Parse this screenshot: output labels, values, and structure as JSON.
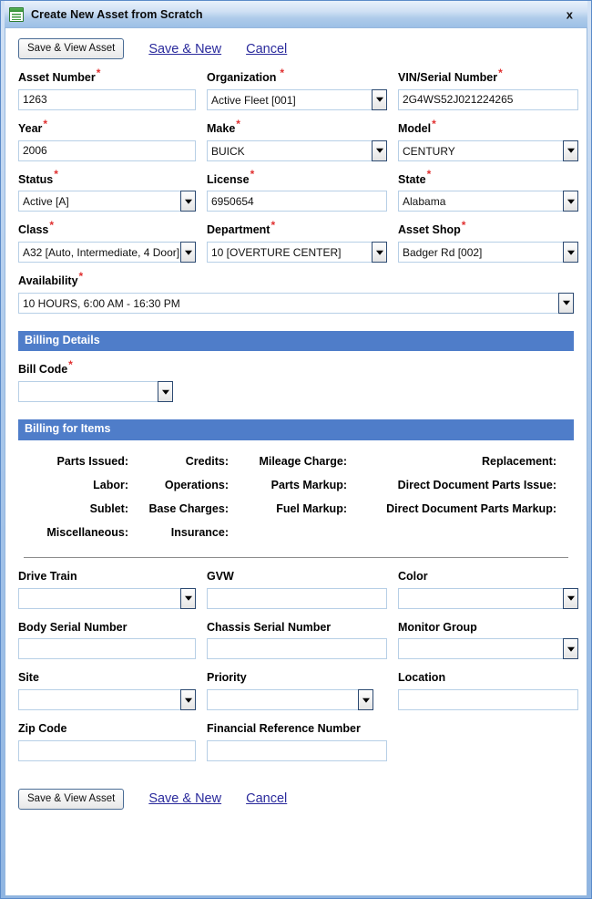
{
  "window": {
    "title": "Create New Asset from Scratch",
    "icon": "window-document-icon",
    "close_label": "x",
    "accent_color": "#4f7dc9",
    "required_marker_color": "#e03030",
    "link_color": "#2a2a9c"
  },
  "toolbar": {
    "save_view_label": "Save & View Asset",
    "save_new_label": "Save & New",
    "cancel_label": "Cancel"
  },
  "fields": {
    "asset_number": {
      "label": "Asset Number",
      "required": true,
      "value": "1263",
      "type": "text"
    },
    "organization": {
      "label": "Organization",
      "required": true,
      "value": "Active Fleet [001]",
      "type": "select"
    },
    "vin": {
      "label": "VIN/Serial Number",
      "required": true,
      "value": "2G4WS52J021224265",
      "type": "text"
    },
    "year": {
      "label": "Year",
      "required": true,
      "value": "2006",
      "type": "text"
    },
    "make": {
      "label": "Make",
      "required": true,
      "value": "BUICK",
      "type": "select"
    },
    "model": {
      "label": "Model",
      "required": true,
      "value": "CENTURY",
      "type": "select"
    },
    "status": {
      "label": "Status",
      "required": true,
      "value": "Active [A]",
      "type": "select"
    },
    "license": {
      "label": "License",
      "required": true,
      "value": "6950654",
      "type": "text"
    },
    "state": {
      "label": "State",
      "required": true,
      "value": "Alabama",
      "type": "select"
    },
    "class": {
      "label": "Class",
      "required": true,
      "value": "A32 [Auto, Intermediate, 4 Door]",
      "type": "select"
    },
    "department": {
      "label": "Department",
      "required": true,
      "value": "10 [OVERTURE CENTER]",
      "type": "select"
    },
    "asset_shop": {
      "label": "Asset Shop",
      "required": true,
      "value": "Badger Rd [002]",
      "type": "select"
    },
    "availability": {
      "label": "Availability",
      "required": true,
      "value": "10 HOURS, 6:00 AM - 16:30 PM",
      "type": "select"
    },
    "bill_code": {
      "label": "Bill Code",
      "required": true,
      "value": "",
      "type": "select"
    },
    "drive_train": {
      "label": "Drive Train",
      "required": false,
      "value": "",
      "type": "select"
    },
    "gvw": {
      "label": "GVW",
      "required": false,
      "value": "",
      "type": "text"
    },
    "color": {
      "label": "Color",
      "required": false,
      "value": "",
      "type": "select"
    },
    "body_serial": {
      "label": "Body Serial Number",
      "required": false,
      "value": "",
      "type": "text"
    },
    "chassis_serial": {
      "label": "Chassis Serial Number",
      "required": false,
      "value": "",
      "type": "text"
    },
    "monitor_group": {
      "label": "Monitor Group",
      "required": false,
      "value": "",
      "type": "select"
    },
    "site": {
      "label": "Site",
      "required": false,
      "value": "",
      "type": "select"
    },
    "priority": {
      "label": "Priority",
      "required": false,
      "value": "",
      "type": "select"
    },
    "location": {
      "label": "Location",
      "required": false,
      "value": "",
      "type": "text"
    },
    "zip_code": {
      "label": "Zip Code",
      "required": false,
      "value": "",
      "type": "text"
    },
    "financial_ref": {
      "label": "Financial Reference Number",
      "required": false,
      "value": "",
      "type": "text"
    }
  },
  "sections": {
    "billing_details": "Billing Details",
    "billing_for_items": "Billing for Items"
  },
  "billing_for_items": {
    "rows": [
      [
        "Parts Issued:",
        "Credits:",
        "Mileage Charge:",
        "Replacement:"
      ],
      [
        "Labor:",
        "Operations:",
        "Parts Markup:",
        "Direct Document Parts Issue:"
      ],
      [
        "Sublet:",
        "Base Charges:",
        "Fuel Markup:",
        "Direct Document Parts Markup:"
      ],
      [
        "Miscellaneous:",
        "Insurance:",
        "",
        ""
      ]
    ]
  }
}
